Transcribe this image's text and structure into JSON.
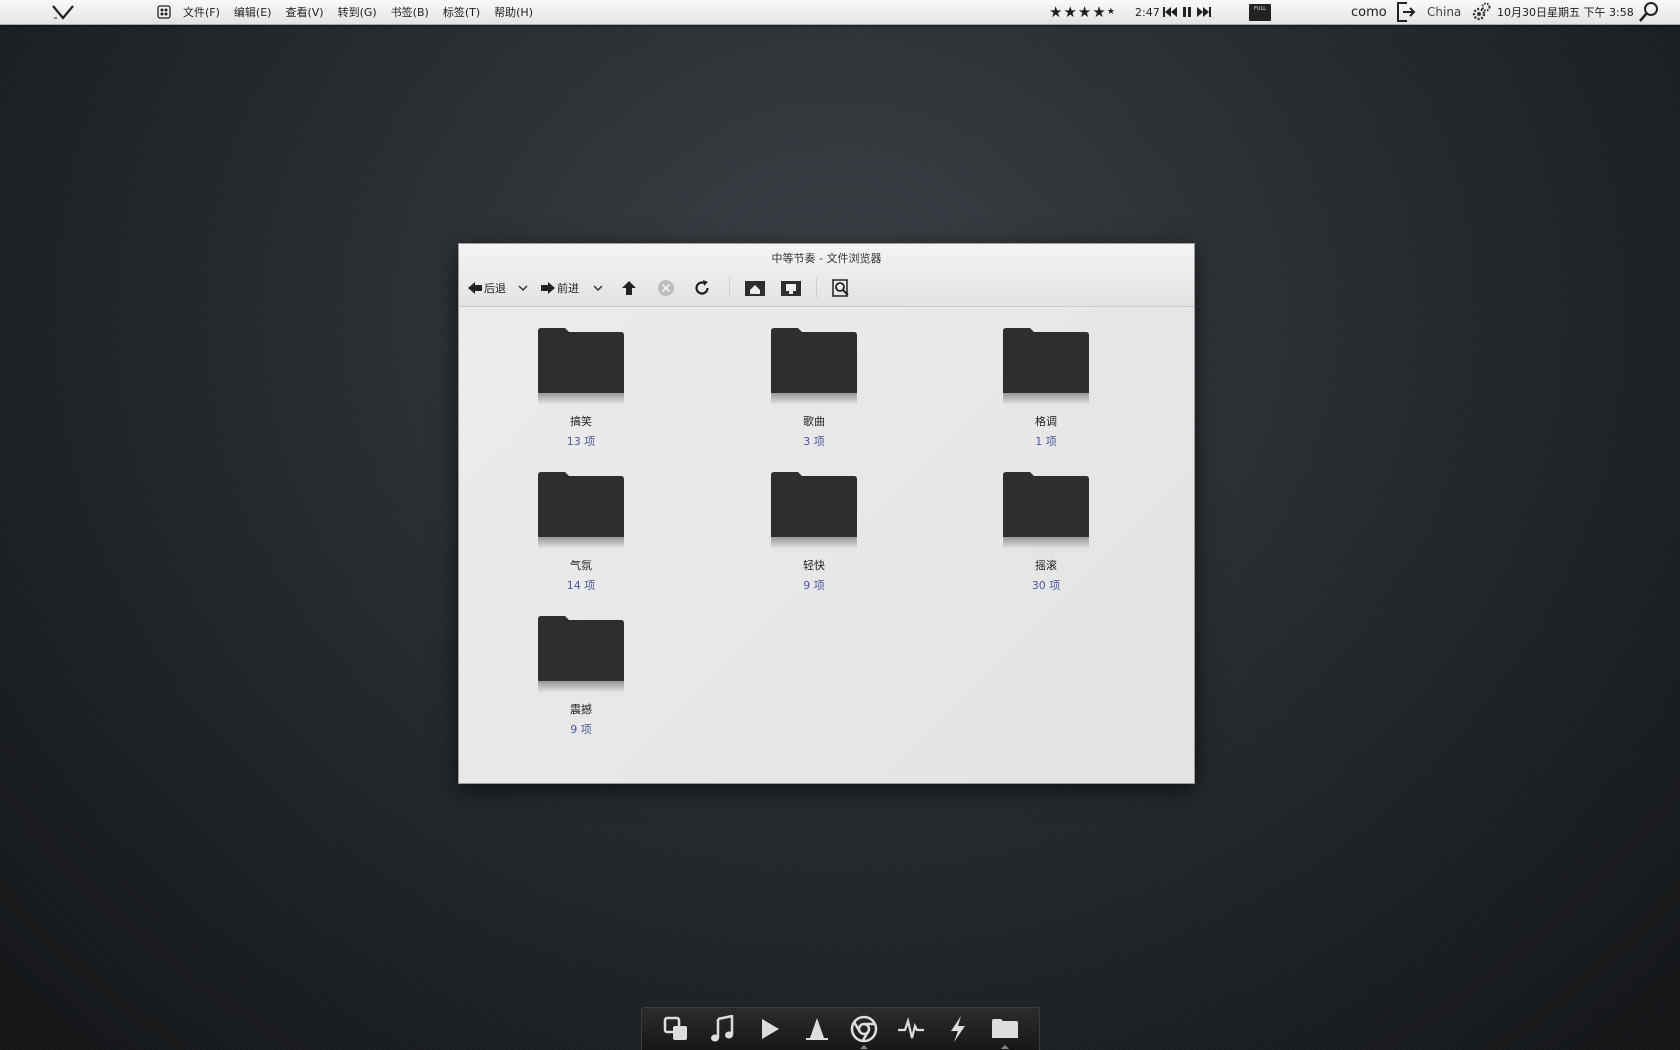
{
  "top_panel": {
    "menus": [
      "文件(F)",
      "编辑(E)",
      "查看(V)",
      "转到(G)",
      "书签(B)",
      "标签(T)",
      "帮助(H)"
    ],
    "rating_stars": 4,
    "time_elapsed": "2:47",
    "full_badge": "FULL",
    "user": "como",
    "location": "China",
    "clock": "10月30日星期五 下午 3:58"
  },
  "window": {
    "title": "中等节奏 - 文件浏览器",
    "toolbar": {
      "back_label": "后退",
      "forward_label": "前进"
    },
    "folders": [
      {
        "name": "搞笑",
        "count": "13 项"
      },
      {
        "name": "歌曲",
        "count": "3 项"
      },
      {
        "name": "格调",
        "count": "1 项"
      },
      {
        "name": "气氛",
        "count": "14 项"
      },
      {
        "name": "轻快",
        "count": "9 项"
      },
      {
        "name": "摇滚",
        "count": "30 项"
      },
      {
        "name": "震撼",
        "count": "9 项"
      }
    ]
  },
  "dock": {
    "items": [
      "windows-icon",
      "music-icon",
      "play-icon",
      "cone-icon",
      "chrome-icon",
      "pulse-icon",
      "lightning-icon",
      "folder-icon"
    ],
    "active": "folder-icon"
  },
  "colors": {
    "folder": "#2e2e2e",
    "count_text": "#4a57a0"
  }
}
